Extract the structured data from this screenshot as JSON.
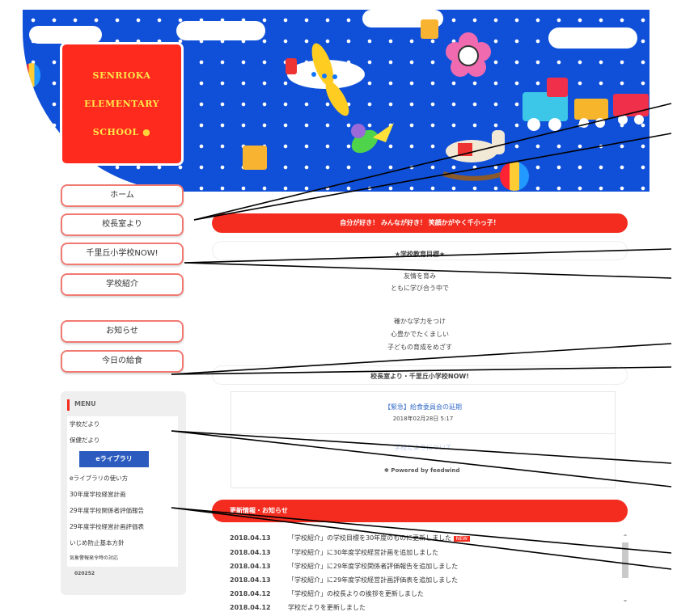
{
  "logo": {
    "line1": "SENRIOKA",
    "line2": "ELEMENTARY",
    "line3": "SCHOOL"
  },
  "nav": [
    {
      "label": "ホーム"
    },
    {
      "label": "校長室より"
    },
    {
      "label": "千里丘小学校NOW!"
    },
    {
      "label": "学校紹介"
    },
    {
      "label": "お知らせ"
    },
    {
      "label": "今日の給食"
    }
  ],
  "motto": {
    "banner": "自分が好き！ みんなが好き！ 笑顔かがやく千小っ子！"
  },
  "goals": {
    "title": "★学校教育目標★",
    "lines": [
      "友情を育み",
      "ともに学び合う中で",
      "確かな学力をつけ",
      "心豊かでたくましい",
      "子どもの育成をめざす"
    ]
  },
  "feed": {
    "header": "校長室より・千里丘小学校NOW!",
    "item_title": "【緊急】給食委員会の延期",
    "item_date": "2018年02月28日 5:17",
    "faded_link": "学校だよりについて",
    "powered": "Powered by feedwind"
  },
  "menu": {
    "title": "MENU",
    "items": [
      "学校だより",
      "保健だより",
      "eライブラリの使い方",
      "30年度学校経営計画",
      "29年度学校関係者評価報告",
      "29年度学校経営計画評価表",
      "いじめ防止基本方針",
      "気象警報発令時の対応"
    ],
    "counter": "020252",
    "elib_label": "eライブラリ"
  },
  "news": {
    "header": "更新情報・お知らせ",
    "new_badge": "NEW",
    "rows": [
      {
        "date": "2018.04.13",
        "text": "「学校紹介」の学校目標を30年度のものに更新しました"
      },
      {
        "date": "2018.04.13",
        "text": "「学校紹介」に30年度学校経営計画を追加しました"
      },
      {
        "date": "2018.04.13",
        "text": "「学校紹介」に29年度学校関係者評価報告を追加しました"
      },
      {
        "date": "2018.04.13",
        "text": "「学校紹介」に29年度学校経営計画評価表を追加しました"
      },
      {
        "date": "2018.04.12",
        "text": "「学校紹介」の校長よりの挨拶を更新しました"
      },
      {
        "date": "2018.04.12",
        "text": "学校だよりを更新しました"
      }
    ]
  },
  "colors": {
    "header_blue": "#1050d8",
    "accent_red": "#f32c1f",
    "logo_yellow": "#ffe84a"
  }
}
